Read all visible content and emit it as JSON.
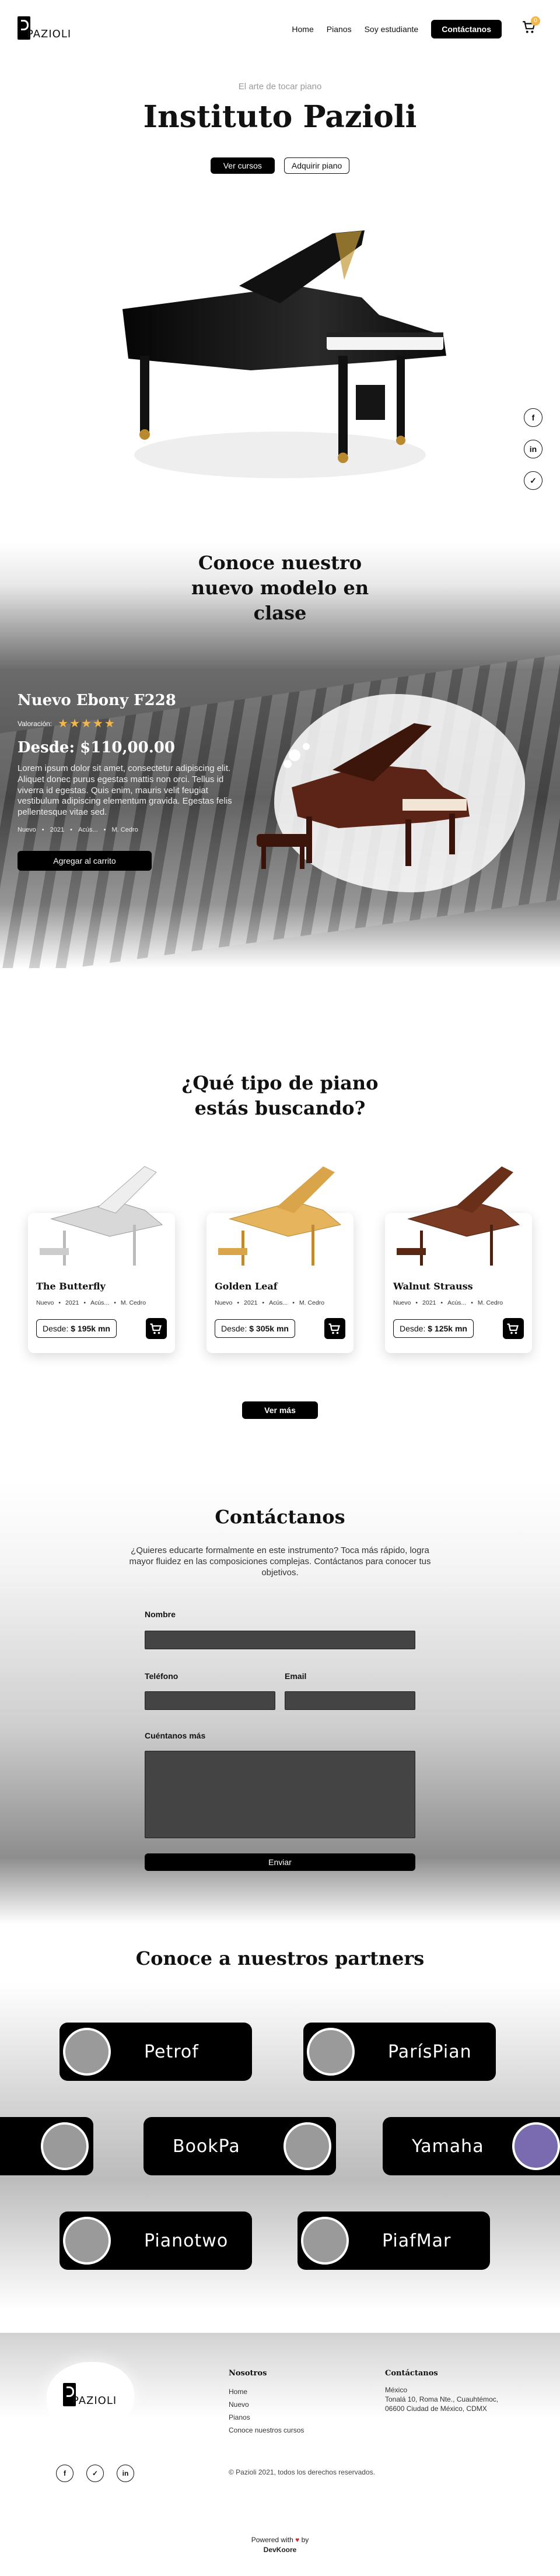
{
  "brand": {
    "logo_text": "PAZIOLI"
  },
  "nav": {
    "items": [
      "Home",
      "Pianos",
      "Soy estudiante"
    ],
    "cta": "Contáctanos",
    "cart_count": "0"
  },
  "hero": {
    "tagline": "El arte de tocar piano",
    "title": "Instituto Pazioli",
    "primary_button": "Ver cursos",
    "secondary_button": "Adquirir piano"
  },
  "social": {
    "icons": [
      "facebook-icon",
      "linkedin-icon",
      "twitter-icon"
    ]
  },
  "featured": {
    "title": "Conoce nuestro nuevo modelo en clase",
    "product_name": "Nuevo Ebony F228",
    "rating_label": "Valoración:",
    "rating": 5,
    "price": "Desde: $110,00.00",
    "description": "Lorem ipsum dolor sit amet, consectetur adipiscing elit. Aliquet donec purus egestas mattis non orci. Tellus id viverra id egestas. Quis enim, mauris velit feugiat vestibulum adipiscing elementum gravida. Egestas felis pellentesque vitae sed.",
    "meta": [
      "Nuevo",
      "2021",
      "Acús...",
      "M. Cedro"
    ],
    "button": "Agregar al carrito"
  },
  "catalog": {
    "title": "¿Qué tipo de piano estás buscando?",
    "cards": [
      {
        "name": "The Butterfly",
        "meta": [
          "Nuevo",
          "2021",
          "Acús...",
          "M. Cedro"
        ],
        "price_prefix": "Desde:",
        "price": "$ 195k mn"
      },
      {
        "name": "Golden Leaf",
        "meta": [
          "Nuevo",
          "2021",
          "Acús...",
          "M. Cedro"
        ],
        "price_prefix": "Desde:",
        "price": "$ 305k mn"
      },
      {
        "name": "Walnut Strauss",
        "meta": [
          "Nuevo",
          "2021",
          "Acús...",
          "M. Cedro"
        ],
        "price_prefix": "Desde:",
        "price": "$ 125k mn"
      }
    ],
    "more_button": "Ver más"
  },
  "contact": {
    "title": "Contáctanos",
    "lead": "¿Quieres educarte formalmente en este instrumento? Toca más rápido, logra mayor fluidez en las composiciones complejas. Contáctanos para conocer tus objetivos.",
    "name_label": "Nombre",
    "phone_label": "Teléfono",
    "email_label": "Email",
    "message_label": "Cuéntanos más",
    "send_button": "Enviar"
  },
  "partners": {
    "title": "Conoce a nuestros partners",
    "items": [
      "Petrof",
      "ParísPian",
      "BookPa",
      "Yamaha",
      "Pianotwo",
      "PiafMar"
    ]
  },
  "footer": {
    "nosotros_title": "Nosotros",
    "links": [
      "Home",
      "Nuevo",
      "Pianos",
      "Conoce nuestros cursos"
    ],
    "contact_title": "Contáctanos",
    "address": [
      "México",
      "Tonalá 10, Roma Nte., Cuauhtémoc,",
      "06600 Ciudad de México, CDMX"
    ],
    "copyright": "© Pazioli 2021, todos los derechos reservados.",
    "powered_by": "Powered with",
    "powered_by_suffix": "by",
    "company": "DevKoore"
  }
}
